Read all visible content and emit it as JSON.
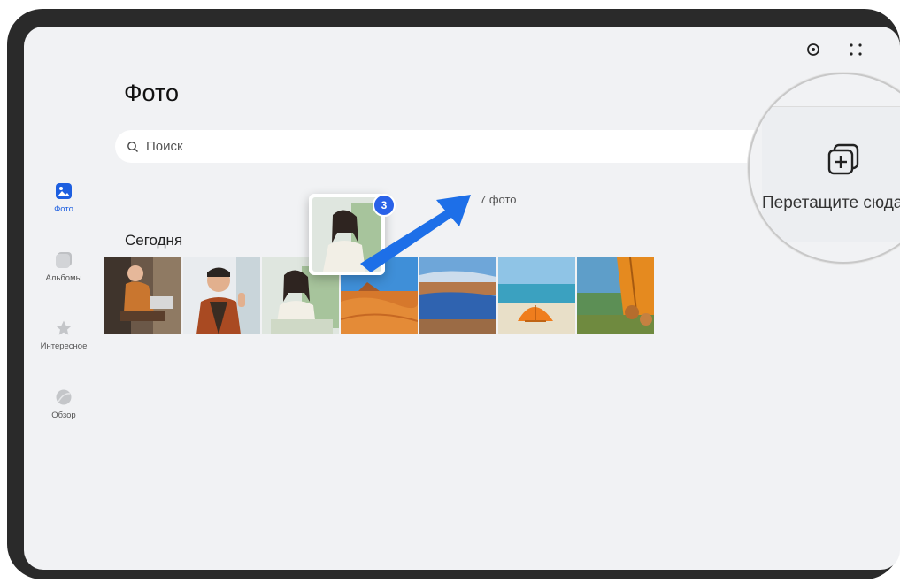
{
  "header": {
    "title": "Фото"
  },
  "search": {
    "placeholder": "Поиск"
  },
  "nav": {
    "items": [
      {
        "label": "Фото",
        "icon": "photo-icon",
        "active": true
      },
      {
        "label": "Альбомы",
        "icon": "album-icon",
        "active": false
      },
      {
        "label": "Интересное",
        "icon": "star-icon",
        "active": false
      },
      {
        "label": "Обзор",
        "icon": "explore-icon",
        "active": false
      }
    ]
  },
  "content": {
    "section_title": "Сегодня",
    "selection_count": "7 фото",
    "drag_badge": "3"
  },
  "drop_zone": {
    "label": "Перетащите сюда",
    "icon": "add-to-album-icon"
  },
  "colors": {
    "accent": "#2a62e8",
    "background": "#f1f2f4",
    "arrow": "#1d6fe8"
  }
}
